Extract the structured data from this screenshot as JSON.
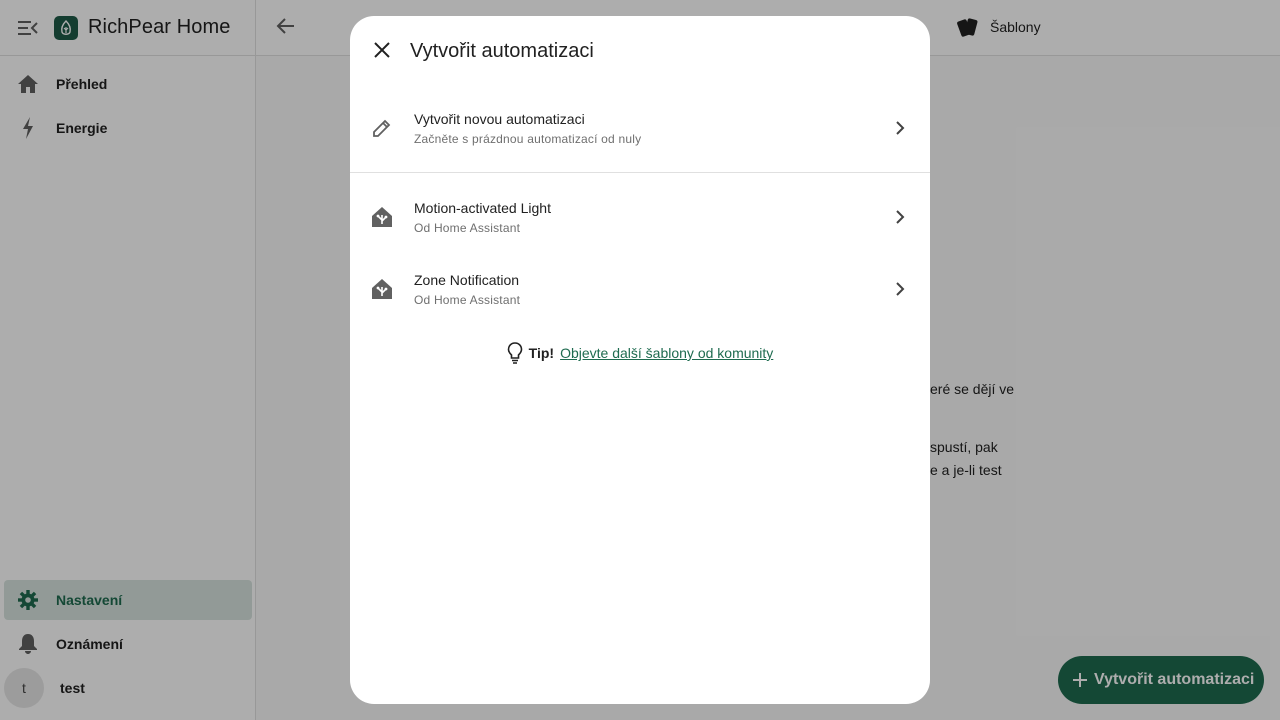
{
  "app": {
    "title": "RichPear Home"
  },
  "sidebar": {
    "items": [
      {
        "label": "Přehled",
        "icon": "home-icon"
      },
      {
        "label": "Energie",
        "icon": "lightning-icon"
      }
    ],
    "bottom": [
      {
        "label": "Nastavení",
        "icon": "gear-icon",
        "active": true
      },
      {
        "label": "Oznámení",
        "icon": "bell-icon"
      }
    ],
    "user": {
      "initial": "t",
      "name": "test"
    }
  },
  "topbar": {
    "templates_label": "Šablony"
  },
  "background_text": {
    "line1": "eré se dějí ve",
    "line2": "spustí, pak",
    "line3": "e a je-li test"
  },
  "fab": {
    "label": "Vytvořit automatizaci"
  },
  "dialog": {
    "title": "Vytvořit automatizaci",
    "new": {
      "title": "Vytvořit novou automatizaci",
      "subtitle": "Začněte s prázdnou automatizací od nuly"
    },
    "blueprints": [
      {
        "title": "Motion-activated Light",
        "subtitle": "Od Home Assistant"
      },
      {
        "title": "Zone Notification",
        "subtitle": "Od Home Assistant"
      }
    ],
    "tip": {
      "label": "Tip!",
      "link_text": "Objevte další šablony od komunity"
    }
  },
  "colors": {
    "accent": "#1e6b4f",
    "logo": "#1e5b48",
    "active_bg": "#d7e4df"
  }
}
